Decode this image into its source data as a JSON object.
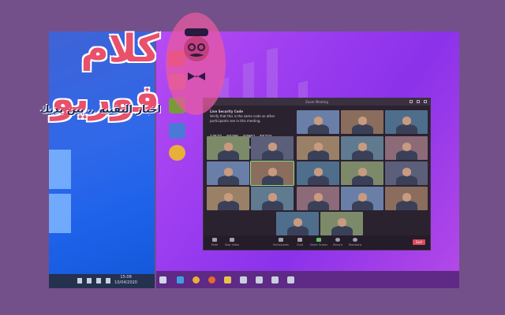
{
  "watermark": {
    "title": "كلام فوريو",
    "subtitle": "اخبار التقنيه .. بين يديك"
  },
  "left_screen": {
    "taskbar_time": "15:08",
    "taskbar_date": "10/04/2020"
  },
  "floating_apps": [
    {
      "name": "youtube-icon",
      "color": "#e64a3b"
    },
    {
      "name": "zoom-video-icon",
      "color": "#d9668c"
    },
    {
      "name": "whatsapp-icon",
      "color": "#7a9a3a"
    },
    {
      "name": "dropbox-icon",
      "color": "#4b79d6"
    },
    {
      "name": "chrome-icon",
      "color": "#e8b03a"
    }
  ],
  "zoom": {
    "window_title": "Zoom Meeting",
    "chat": {
      "heading": "Live Security Code",
      "body": "Verify that this is the same code as other participants see in this meeting.",
      "codes": [
        "17577",
        "03286",
        "07802",
        "55719",
        "73048",
        "82390",
        "18466",
        "67205"
      ]
    },
    "toolbar": {
      "mute": "Mute",
      "stop_video": "Stop Video",
      "participants": "Participants",
      "chat": "Chat",
      "share_screen": "Share Screen",
      "record": "Record",
      "reactions": "Reactions",
      "end": "End"
    }
  },
  "colors": {
    "left_screen": "#2f68e9",
    "right_screen": "#9a3cf0",
    "zoom_window": "#2b2230",
    "end_button": "#d94b5e"
  }
}
